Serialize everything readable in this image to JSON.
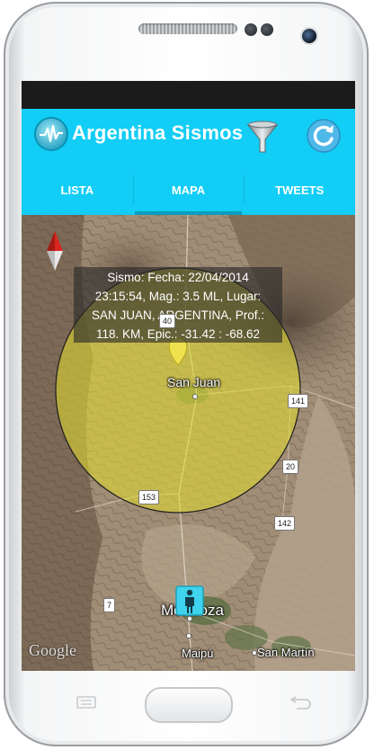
{
  "app": {
    "title": "Argentina Sismos",
    "accent_color": "#12cdf5",
    "icons": [
      "app-seismograph-icon",
      "filter-funnel-icon",
      "refresh-icon"
    ]
  },
  "tabs": [
    {
      "label": "LISTA",
      "active": false
    },
    {
      "label": "MAPA",
      "active": true
    },
    {
      "label": "TWEETS",
      "active": false
    }
  ],
  "map": {
    "info_window": {
      "line1": "Sismo: Fecha: 22/04/2014",
      "line2": "23:15:54, Mag.: 3.5 ML, Lugar:",
      "line3": "SAN JUAN, ARGENTINA, Prof.:",
      "line4": "118. KM, Epic.: -31.42 : -68.62"
    },
    "places": {
      "san_juan": "San Juan",
      "mendoza": "Mendoza",
      "maipu": "Maipú",
      "san_martin": "San Martín"
    },
    "road_shields": {
      "r40": "40",
      "r141": "141",
      "r20": "20",
      "r153": "153",
      "r142": "142",
      "r7": "7"
    },
    "attribution": "Google",
    "circle_color": "#e6e030"
  }
}
